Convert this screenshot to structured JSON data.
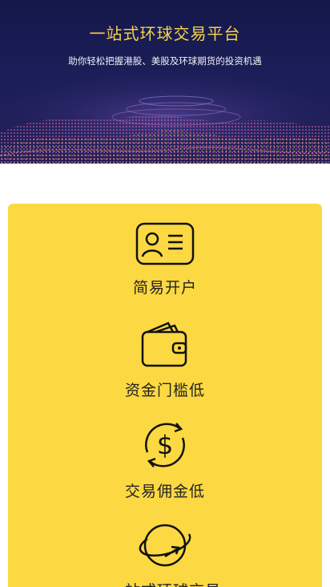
{
  "hero": {
    "title": "一站式环球交易平台",
    "subtitle": "助你轻松把握港股、美股及环球期货的投资机遇"
  },
  "features": [
    {
      "label": "简易开户",
      "icon": "id-card-icon"
    },
    {
      "label": "资金门槛低",
      "icon": "wallet-icon"
    },
    {
      "label": "交易佣金低",
      "icon": "dollar-exchange-icon"
    },
    {
      "label": "一站式环球交易",
      "icon": "globe-orbit-icon"
    }
  ],
  "colors": {
    "accent": "#fcd842",
    "hero_bg": "#1b1e58",
    "title": "#f6d24a"
  }
}
